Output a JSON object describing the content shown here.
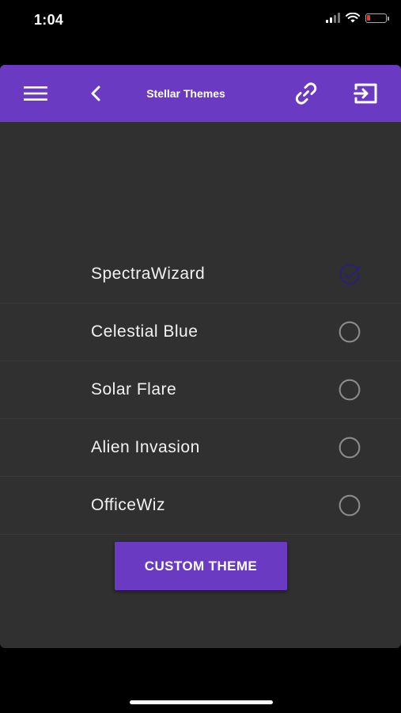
{
  "status_bar": {
    "time": "1:04",
    "battery_color": "#e53935"
  },
  "app_bar": {
    "title": "Stellar Themes",
    "background": "#6a3bc2",
    "icons": {
      "menu": "menu-icon",
      "back": "chevron-left-icon",
      "link": "link-icon",
      "exit": "exit-icon"
    }
  },
  "themes": [
    {
      "label": "SpectraWizard",
      "selected": true
    },
    {
      "label": "Celestial Blue",
      "selected": false
    },
    {
      "label": "Solar Flare",
      "selected": false
    },
    {
      "label": "Alien Invasion",
      "selected": false
    },
    {
      "label": "OfficeWiz",
      "selected": false
    }
  ],
  "custom_theme_button": "CUSTOM THEME",
  "colors": {
    "accent": "#6a3bc2",
    "panel_background": "#303030",
    "selected_check": "#2a2270",
    "radio_outline": "#8a8a8a"
  }
}
